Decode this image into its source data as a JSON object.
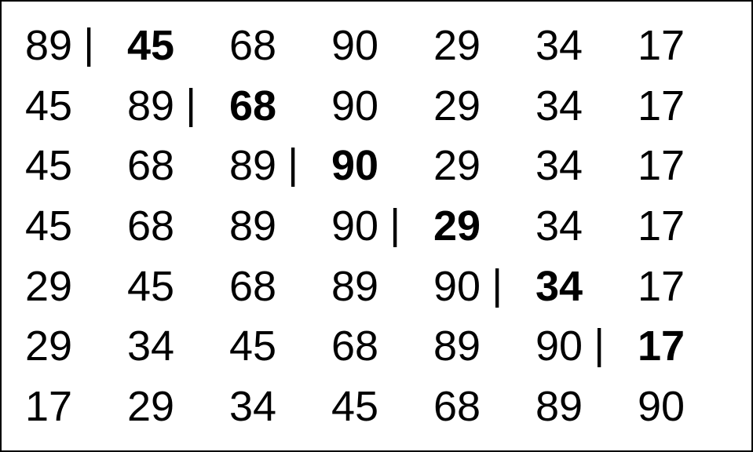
{
  "separator_glyph": "|",
  "rows": [
    {
      "values": [
        "89",
        "45",
        "68",
        "90",
        "29",
        "34",
        "17"
      ],
      "bold_index": 1,
      "sep_after_index": 0
    },
    {
      "values": [
        "45",
        "89",
        "68",
        "90",
        "29",
        "34",
        "17"
      ],
      "bold_index": 2,
      "sep_after_index": 1
    },
    {
      "values": [
        "45",
        "68",
        "89",
        "90",
        "29",
        "34",
        "17"
      ],
      "bold_index": 3,
      "sep_after_index": 2
    },
    {
      "values": [
        "45",
        "68",
        "89",
        "90",
        "29",
        "34",
        "17"
      ],
      "bold_index": 4,
      "sep_after_index": 3
    },
    {
      "values": [
        "29",
        "45",
        "68",
        "89",
        "90",
        "34",
        "17"
      ],
      "bold_index": 5,
      "sep_after_index": 4
    },
    {
      "values": [
        "29",
        "34",
        "45",
        "68",
        "89",
        "90",
        "17"
      ],
      "bold_index": 6,
      "sep_after_index": 5
    },
    {
      "values": [
        "17",
        "29",
        "34",
        "45",
        "68",
        "89",
        "90"
      ],
      "bold_index": -1,
      "sep_after_index": -1
    }
  ]
}
